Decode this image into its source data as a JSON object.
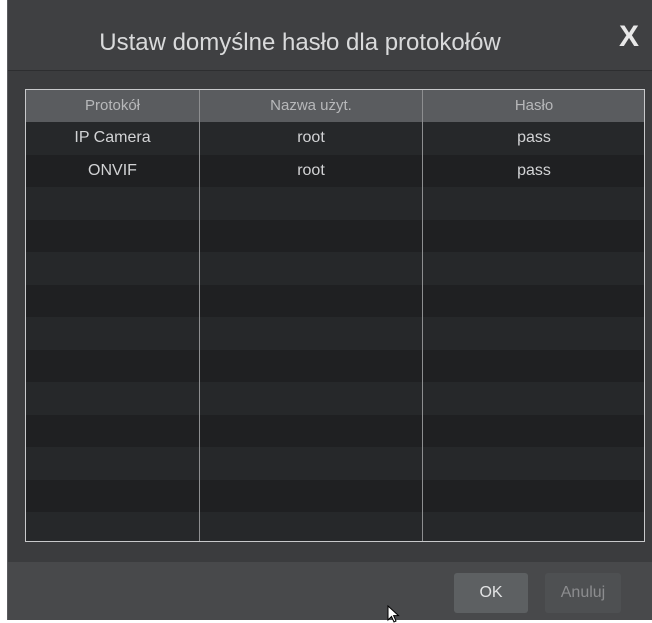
{
  "dialog": {
    "title": "Ustaw domyślne hasło dla protokołów",
    "close_glyph": "X"
  },
  "table": {
    "headers": [
      "Protokół",
      "Nazwa użyt.",
      "Hasło"
    ],
    "rows": [
      [
        "IP Camera",
        "root",
        "pass"
      ],
      [
        "ONVIF",
        "root",
        "pass"
      ],
      [
        "",
        "",
        ""
      ],
      [
        "",
        "",
        ""
      ],
      [
        "",
        "",
        ""
      ],
      [
        "",
        "",
        ""
      ],
      [
        "",
        "",
        ""
      ],
      [
        "",
        "",
        ""
      ],
      [
        "",
        "",
        ""
      ],
      [
        "",
        "",
        ""
      ],
      [
        "",
        "",
        ""
      ],
      [
        "",
        "",
        ""
      ],
      [
        "",
        "",
        ""
      ]
    ]
  },
  "footer": {
    "ok_label": "OK",
    "cancel_label": "Anuluj"
  },
  "icons": {
    "close": "close-icon",
    "cursor": "mouse-pointer-icon"
  },
  "colors": {
    "dialog_bg": "#3a3b3d",
    "header_bg": "#5a5c5f",
    "row_odd": "#1f2022",
    "row_even": "#26282a"
  }
}
